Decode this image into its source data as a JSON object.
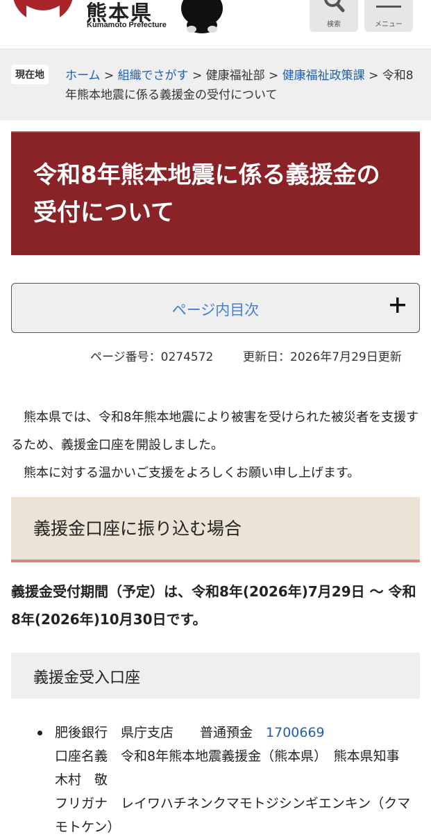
{
  "header": {
    "pref_name": "熊本県",
    "pref_en": "Kumamoto Prefecture",
    "search_label": "検索",
    "menu_label": "メニュー"
  },
  "breadcrumb": {
    "here_label": "現在地",
    "items": [
      {
        "label": "ホーム",
        "link": true
      },
      {
        "label": "組織でさがす",
        "link": true
      },
      {
        "label": "健康福祉部",
        "link": false
      },
      {
        "label": "健康福祉政策課",
        "link": true
      }
    ],
    "current": "令和8年熊本地震に係る義援金の受付について",
    "separator": ">"
  },
  "page": {
    "title": "令和8年熊本地震に係る義援金の受付について",
    "toc_label": "ページ内目次",
    "page_number": "ページ番号：0274572",
    "updated": "更新日：2026年7月29日更新",
    "intro_1": "熊本県では、令和8年熊本地震により被害を受けられた被災者を支援するため、義援金口座を開設しました。",
    "intro_2": "熊本に対する温かいご支援をよろしくお願い申し上げます。"
  },
  "section": {
    "heading": "義援金口座に振り込む場合",
    "period": "義援金受付期間（予定）は、令和8年(2026年)7月29日 ～ 令和8年(2026年)10月30日です。",
    "subheading": "義援金受入口座",
    "account": {
      "bank": "肥後銀行　県庁支店　　普通預金",
      "number": "1700669",
      "holder": "口座名義　令和8年熊本地震義援金（熊本県）　熊本県知事　木村　敬",
      "furigana": "フリガナ　レイワハチネンクマモトジシンギエンキン（クマモトケン）"
    }
  },
  "colors": {
    "title_bg": "#8a2328",
    "link": "#1f5fae",
    "toc_text": "#3f80d6",
    "section_bg": "#ebe3d5",
    "section_border": "#d38a7f"
  }
}
